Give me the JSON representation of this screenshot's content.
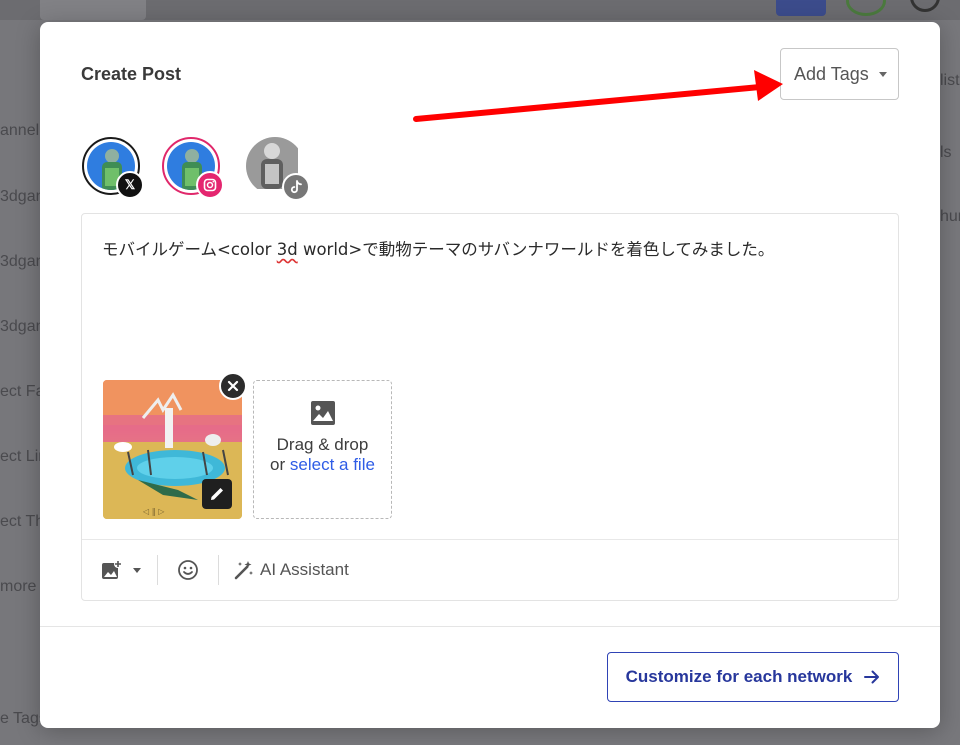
{
  "background": {
    "sidebar_snippets": [
      "annel",
      "3dgam",
      "3dgam",
      "3dgam",
      "ect Fa",
      "ect Lin",
      "ect Th",
      "more",
      "e Tags"
    ],
    "right_snippets": [
      "list",
      "ls",
      "hur"
    ]
  },
  "modal": {
    "title": "Create Post",
    "add_tags_label": "Add Tags",
    "accounts": [
      {
        "network": "x",
        "badge_icon": "x-logo-icon"
      },
      {
        "network": "instagram",
        "badge_icon": "instagram-logo-icon"
      },
      {
        "network": "tiktok",
        "badge_icon": "tiktok-logo-icon"
      }
    ],
    "post": {
      "text_before": "モバイルゲーム<color ",
      "text_misspelled": "3d",
      "text_after": " world>で動物テーマのサバンナワールドを着色してみました。"
    },
    "dropzone": {
      "line1": "Drag & drop",
      "line2_prefix": "or ",
      "link_text": "select a file"
    },
    "toolbar": {
      "ai_label": "AI Assistant"
    },
    "customize_label": "Customize for each network"
  },
  "colors": {
    "accent": "#2f43b5",
    "link": "#2e5ce6",
    "arrow": "#ff0000",
    "instagram": "#e4266f"
  }
}
